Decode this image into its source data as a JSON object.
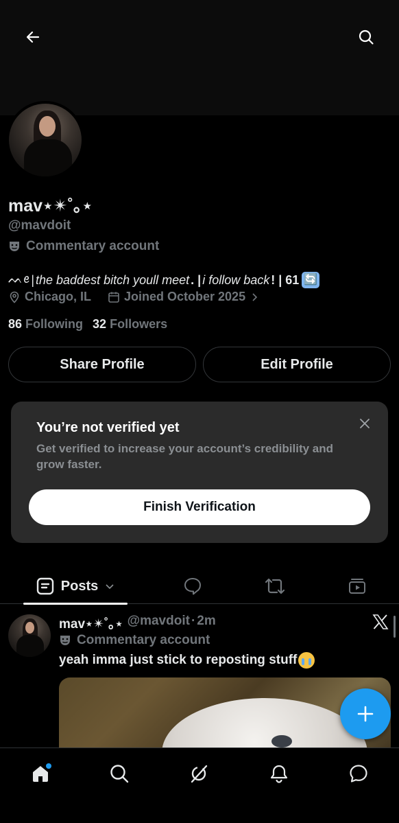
{
  "colors": {
    "background": "#000000",
    "text_primary": "#e7e9ea",
    "text_secondary": "#71767b",
    "accent": "#1d9bf0",
    "card_bg": "#2b2b2b"
  },
  "header": {
    "back_icon": "arrow-left-icon",
    "search_icon": "search-icon"
  },
  "profile": {
    "display_name": "mav⋆✴︎˚｡⋆",
    "handle": "@mavdoit",
    "category_icon": "theater-masks-icon",
    "category": "Commentary account",
    "bio_prefix": "ᨓꫀ",
    "bio_sep1": " | ",
    "bio_text1": "the baddest bitch youll meet",
    "bio_sep2": " . | ",
    "bio_text2": "i follow back",
    "bio_sep3": " ! | 61",
    "bio_emoji": "🔄",
    "location": "Chicago, IL",
    "joined": "Joined October 2025",
    "following_count": "86",
    "following_label": "Following",
    "followers_count": "32",
    "followers_label": "Followers"
  },
  "actions": {
    "share_label": "Share Profile",
    "edit_label": "Edit Profile"
  },
  "verify": {
    "title": "You’re not verified yet",
    "description": "Get verified to increase your account’s credibility and grow faster.",
    "button_label": "Finish Verification"
  },
  "tabs": {
    "posts_label": "Posts"
  },
  "post": {
    "author_name": "mav⋆✴︎˚｡⋆",
    "author_handle": "@mavdoit",
    "dot": "·",
    "time": "2m",
    "category": "Commentary account",
    "text": "yeah imma just stick to reposting stuff"
  },
  "nav": {
    "items": [
      "home-icon",
      "search-icon",
      "grok-icon",
      "notifications-icon",
      "messages-icon"
    ]
  }
}
